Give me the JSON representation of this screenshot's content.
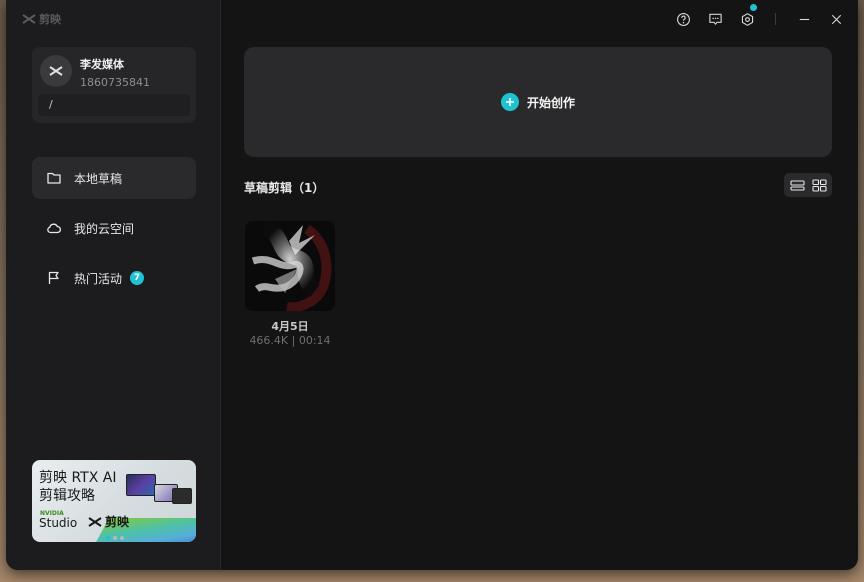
{
  "app": {
    "brand": "剪映"
  },
  "profile": {
    "name": "李发媒体",
    "id": "1860735841",
    "path": "/"
  },
  "nav": [
    {
      "label": "本地草稿",
      "icon": "folder-icon",
      "active": true
    },
    {
      "label": "我的云空间",
      "icon": "cloud-icon",
      "active": false
    },
    {
      "label": "热门活动",
      "icon": "flag-icon",
      "active": false,
      "badge": "7"
    }
  ],
  "promo": {
    "line1": "剪映 RTX AI",
    "line2": "剪辑攻略",
    "nvidia": "NVIDIA",
    "studio": "Studio",
    "brand": "剪映"
  },
  "titlebar": {
    "icons": [
      "help-icon",
      "feedback-icon",
      "settings-icon",
      "minimize-icon",
      "close-icon"
    ]
  },
  "main": {
    "create_label": "开始创作",
    "section_title": "草稿剪辑（1）",
    "drafts": [
      {
        "name": "4月5日",
        "meta": "466.4K | 00:14"
      }
    ]
  },
  "colors": {
    "accent": "#1fc2d1",
    "background": "#141414",
    "sidebar": "#1c1c1e",
    "card": "#2a2a2c"
  }
}
